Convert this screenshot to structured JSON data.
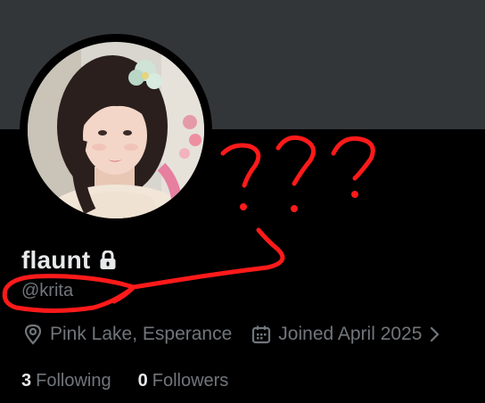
{
  "profile": {
    "display_name": "flaunt",
    "handle": "@krita",
    "location": "Pink Lake, Esperance",
    "joined": "Joined April 2025",
    "protected_icon": "lock-icon"
  },
  "stats": {
    "following_count": "3",
    "following_label": "Following",
    "followers_count": "0",
    "followers_label": "Followers"
  },
  "icons": {
    "location": "location-pin-icon",
    "calendar": "calendar-icon",
    "more": "chevron-right-icon"
  },
  "annotation": {
    "text": "???",
    "color": "#ff1a1a"
  },
  "colors": {
    "background": "#000000",
    "banner": "#333639",
    "primary_text": "#e7e9ea",
    "secondary_text": "#71767b"
  }
}
